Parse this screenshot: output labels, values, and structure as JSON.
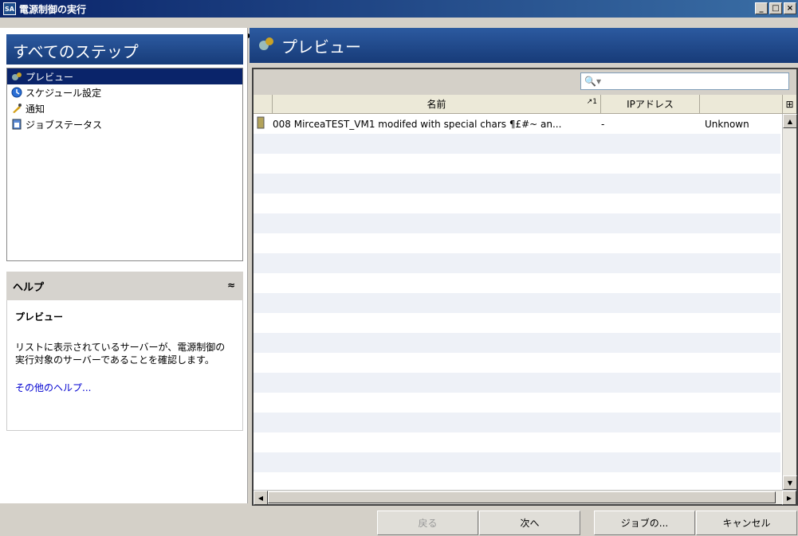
{
  "window": {
    "title": "電源制御の実行",
    "app_icon_text": "SA",
    "minimize": "_",
    "maximize": "□",
    "close": "×"
  },
  "sidebar": {
    "header": "すべてのステップ",
    "steps": [
      {
        "label": "プレビュー",
        "icon": "preview-icon",
        "selected": true
      },
      {
        "label": "スケジュール設定",
        "icon": "schedule-icon",
        "selected": false
      },
      {
        "label": "通知",
        "icon": "notification-icon",
        "selected": false
      },
      {
        "label": "ジョブステータス",
        "icon": "job-status-icon",
        "selected": false
      }
    ]
  },
  "help": {
    "header": "ヘルプ",
    "collapse_glyph": "≈",
    "title": "プレビュー",
    "text": "リストに表示されているサーバーが、電源制御の実行対象のサーバーであることを確認します。",
    "link": "その他のヘルプ..."
  },
  "main": {
    "header": "プレビュー",
    "search": {
      "placeholder": "",
      "icon": "search-icon"
    },
    "columns": [
      {
        "label": ""
      },
      {
        "label": "名前",
        "sort": "↗1"
      },
      {
        "label": "IPアドレス"
      },
      {
        "label": ""
      }
    ],
    "rows": [
      {
        "name": "008 MirceaTEST_VM1 modifed with special chars ¶£#~ an...",
        "ip": "-",
        "status": "Unknown"
      }
    ]
  },
  "buttons": {
    "back": "戻る",
    "next": "次へ",
    "job": "ジョブの...",
    "cancel": "キャンセル"
  },
  "colors": {
    "header_blue": "#1f4784",
    "selected": "#0a246a",
    "link": "#0000d0"
  }
}
